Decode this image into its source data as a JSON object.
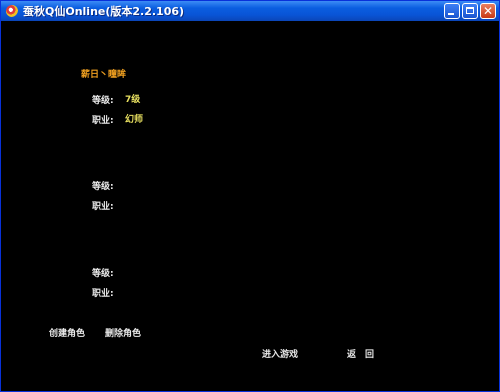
{
  "window": {
    "title": "蚕秋Q仙Online(版本2.2.106)"
  },
  "icons": {
    "app": "app-icon",
    "minimize": "minimize-icon",
    "maximize": "maximize-icon",
    "close": "close-icon"
  },
  "characters": [
    {
      "name": "薪日丶瞳眸",
      "level_label": "等级:",
      "level_value": "7级",
      "job_label": "职业:",
      "job_value": "幻师"
    },
    {
      "name": "",
      "level_label": "等级:",
      "level_value": "",
      "job_label": "职业:",
      "job_value": ""
    },
    {
      "name": "",
      "level_label": "等级:",
      "level_value": "",
      "job_label": "职业:",
      "job_value": ""
    }
  ],
  "actions": {
    "create": "创建角色",
    "delete": "删除角色",
    "enter": "进入游戏",
    "back": "返　回"
  },
  "colors": {
    "name": "#f0a020",
    "value": "#e8e060",
    "label": "#e8e8e8",
    "background": "#000000"
  }
}
